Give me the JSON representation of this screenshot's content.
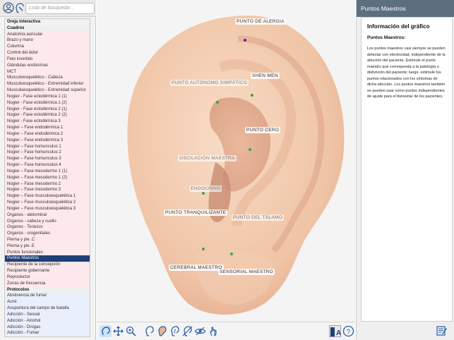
{
  "sidebar": {
    "search_placeholder": "Lista de búsqueda...",
    "top_icons": [
      "user-circle-icon",
      "ear-pointer-icon"
    ],
    "items": [
      {
        "label": "Oreja interactiva",
        "style": "header"
      },
      {
        "label": "Cuadros",
        "style": "section"
      },
      {
        "label": "Anatomía auricular",
        "style": "pink"
      },
      {
        "label": "Brazo y mano",
        "style": "pink"
      },
      {
        "label": "Columna",
        "style": "pink"
      },
      {
        "label": "Control del dolor",
        "style": "pink"
      },
      {
        "label": "Feto invertido",
        "style": "pink"
      },
      {
        "label": "Glándulas endócrinas",
        "style": "pink"
      },
      {
        "label": "MCT",
        "style": "pink"
      },
      {
        "label": "Musculoesquelético - Cabeza",
        "style": "pink"
      },
      {
        "label": "Musculoesquelético - Extremidad inferior",
        "style": "pink"
      },
      {
        "label": "Musculoesquelético - Extremidad superior",
        "style": "pink"
      },
      {
        "label": "Nogier - Fase ectodérmica 1 (1)",
        "style": "pink"
      },
      {
        "label": "Nogier - Fase ectodérmica 1 (2)",
        "style": "pink"
      },
      {
        "label": "Nogier - Fase ectodérmica 2 (1)",
        "style": "pink"
      },
      {
        "label": "Nogier - Fase ectodérmica 2 (2)",
        "style": "pink"
      },
      {
        "label": "Nogier - Fase ectodérmica 3",
        "style": "pink"
      },
      {
        "label": "Nogier – Fase endodérmica 1",
        "style": "pink"
      },
      {
        "label": "Nogier – Fase endodérmica 2",
        "style": "pink"
      },
      {
        "label": "Nogier – Fase endodérmica 3",
        "style": "pink"
      },
      {
        "label": "Nogier – Fase homunculus 1",
        "style": "pink"
      },
      {
        "label": "Nogier – Fase homunculus 2",
        "style": "pink"
      },
      {
        "label": "Nogier – Fase homunculus 3",
        "style": "pink"
      },
      {
        "label": "Nogier – Fase homunculus 4",
        "style": "pink"
      },
      {
        "label": "Nogier – Fase mesodermo 1 (1)",
        "style": "pink"
      },
      {
        "label": "Nogier – Fase mesodermo 1 (2)",
        "style": "pink"
      },
      {
        "label": "Nogier – Fase mesodermo 2",
        "style": "pink"
      },
      {
        "label": "Nogier – Fase mesodermo 3",
        "style": "pink"
      },
      {
        "label": "Nogier – Fase musculoesquelética 1",
        "style": "pink"
      },
      {
        "label": "Nogier – Fase musculoesquelética 2",
        "style": "pink"
      },
      {
        "label": "Nogier – Fase musculoesquelética 3",
        "style": "pink"
      },
      {
        "label": "Órganos - abdominal",
        "style": "pink"
      },
      {
        "label": "Órganos - cabeza y cuello",
        "style": "pink"
      },
      {
        "label": "Órganos - Torácico",
        "style": "pink"
      },
      {
        "label": "Órganos - urogenitales",
        "style": "pink"
      },
      {
        "label": "Pierna y pie .C",
        "style": "pink"
      },
      {
        "label": "Pierna y pie .E",
        "style": "pink"
      },
      {
        "label": "Puntos funcionales",
        "style": "pink"
      },
      {
        "label": "Puntos Maestros",
        "style": "selected"
      },
      {
        "label": "Recipiente de la concepción",
        "style": "pink"
      },
      {
        "label": "Recipiente gobernante",
        "style": "pink"
      },
      {
        "label": "Reproductor",
        "style": "pink"
      },
      {
        "label": "Zonas de frecuencia",
        "style": "pink"
      },
      {
        "label": "Protocolos",
        "style": "section"
      },
      {
        "label": "Abstinencia de fumar",
        "style": "blue"
      },
      {
        "label": "Acné",
        "style": "blue"
      },
      {
        "label": "Acupuntura del campo de batalla",
        "style": "blue"
      },
      {
        "label": "Adicción - Sexual",
        "style": "blue"
      },
      {
        "label": "Adicción - Alcohol",
        "style": "blue"
      },
      {
        "label": "Adicción - Drogas",
        "style": "blue"
      },
      {
        "label": "Adicción - Fumar",
        "style": "blue"
      }
    ]
  },
  "ear": {
    "points": [
      {
        "label": "PUNTO DE ALERGIA",
        "color": "#5a2da0",
        "muted": false
      },
      {
        "label": "SHEN MEN",
        "color": "#3aa845",
        "muted": false
      },
      {
        "label": "PUNTO AUTÓNOMO SIMPÁTICO",
        "color": "#3aa845",
        "muted": true
      },
      {
        "label": "PUNTO CERO",
        "color": "#3aa845",
        "muted": false
      },
      {
        "label": "OSCILACIÓN MAESTRA",
        "color": "#3aa845",
        "muted": true
      },
      {
        "label": "ENDOCRINO",
        "color": "#3aa845",
        "muted": true
      },
      {
        "label": "PUNTO TRANQUILIZANTE",
        "color": "#3aa845",
        "muted": false
      },
      {
        "label": "PUNTO DEL TÁLAMO",
        "color": "#3aa845",
        "muted": true
      },
      {
        "label": "CEREBRAL MAESTRO",
        "color": "#3aa845",
        "muted": false
      },
      {
        "label": "SENSORIAL MAESTRO",
        "color": "#3aa845",
        "muted": false
      }
    ],
    "skin_color": "#f1c9ae",
    "shadow_color": "#d49b80"
  },
  "toolbar": {
    "left_icons": [
      "ear-select-icon",
      "move-arrows-icon",
      "zoom-icon",
      "ear-outline-icon",
      "ear-color-icon",
      "ear-points-icon",
      "ear-hide-icon",
      "eye-hide-icon",
      "hand-pointer-icon"
    ],
    "right_icons": [
      "text-size-icon",
      "help-icon"
    ]
  },
  "right_panel": {
    "header": "Puntos Maestros",
    "title": "Información del gráfico",
    "subtitle": "Puntos Maestros:",
    "body": "Los puntos maestros casi siempre se pueden detectar con electricidad, independiente de la afección del paciente. Estimule el punto maestro que corresponda a la patología o disfunción del paciente; luego, estimule los puntos relacionados con los síntomas de dicha afección. Los puntos maestros también se pueden usar como puntos independientes de ajuste para el bienestar de los pacientes.",
    "footer_icon": "edit-note-icon"
  },
  "colors": {
    "accent": "#1f3f77",
    "header_bg": "#5c6f7f"
  }
}
